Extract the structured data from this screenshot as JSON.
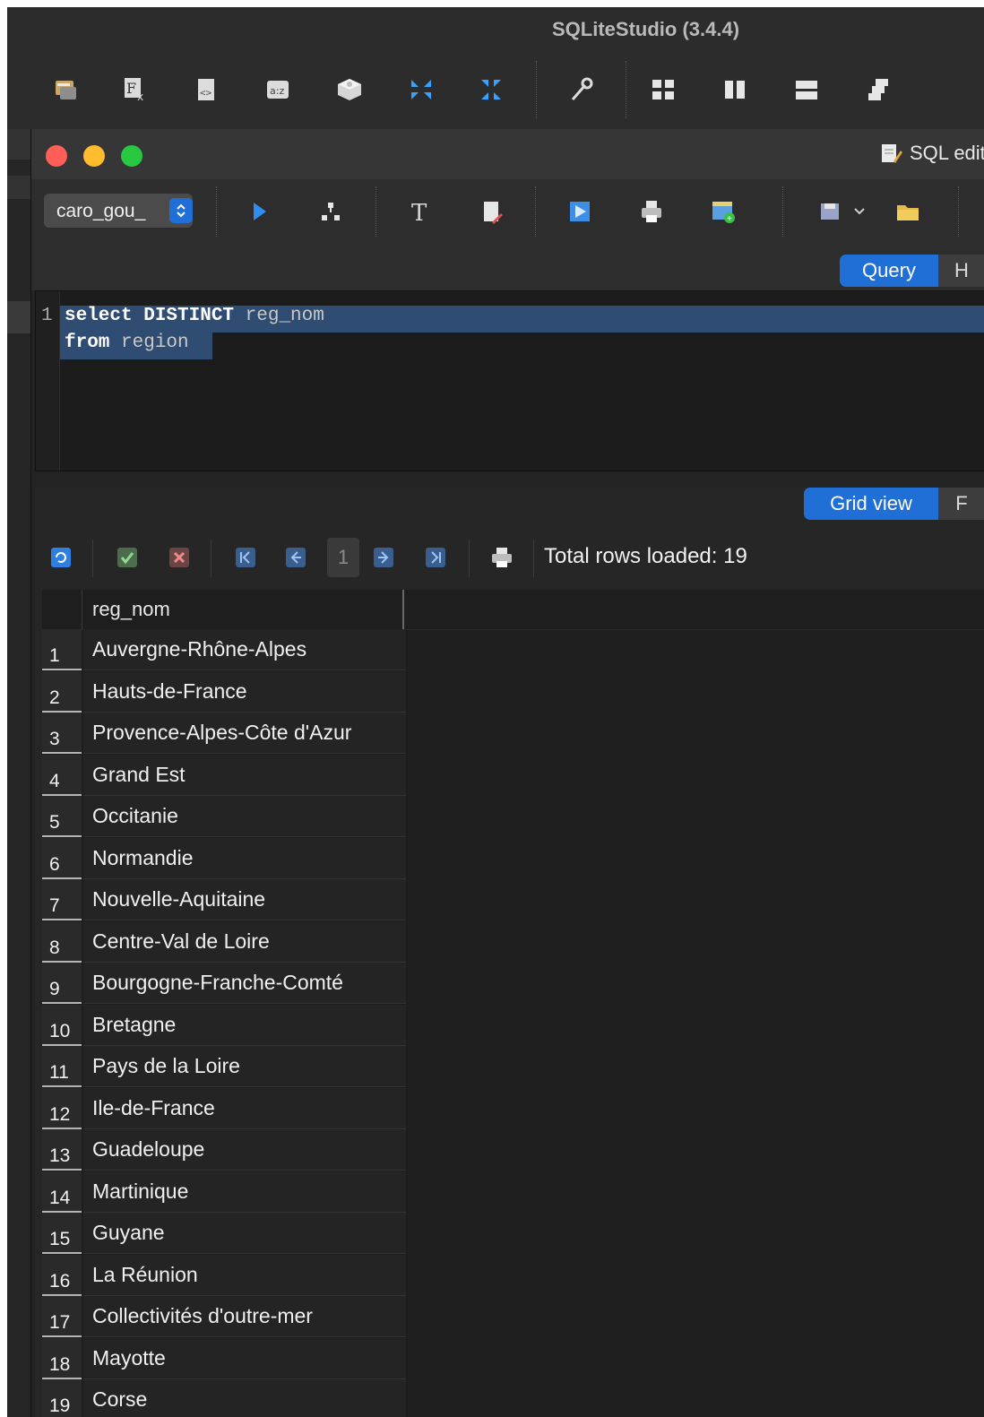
{
  "app": {
    "title": "SQLiteStudio (3.4.4)"
  },
  "editor_window": {
    "title": "SQL edito",
    "database_selector": {
      "value": "caro_gou_"
    },
    "tabs": [
      {
        "label": "Query",
        "active": true
      },
      {
        "label": "H",
        "active": false
      }
    ],
    "code_lines": [
      {
        "number": "1",
        "parts": [
          {
            "text": "select DISTINCT",
            "kind": "keyword"
          },
          {
            "text": " reg_nom",
            "kind": "ident"
          }
        ]
      },
      {
        "number": "",
        "parts": [
          {
            "text": "from",
            "kind": "keyword"
          },
          {
            "text": " region",
            "kind": "ident"
          }
        ]
      }
    ]
  },
  "results": {
    "tabs": [
      {
        "label": "Grid view",
        "active": true
      },
      {
        "label": "F",
        "active": false
      }
    ],
    "current_page": "1",
    "rows_loaded_label": "Total rows loaded: 19",
    "column_header": "reg_nom",
    "rows": [
      {
        "n": "1",
        "value": "Auvergne-Rhône-Alpes"
      },
      {
        "n": "2",
        "value": "Hauts-de-France"
      },
      {
        "n": "3",
        "value": "Provence-Alpes-Côte d'Azur"
      },
      {
        "n": "4",
        "value": "Grand Est"
      },
      {
        "n": "5",
        "value": "Occitanie"
      },
      {
        "n": "6",
        "value": "Normandie"
      },
      {
        "n": "7",
        "value": "Nouvelle-Aquitaine"
      },
      {
        "n": "8",
        "value": "Centre-Val de Loire"
      },
      {
        "n": "9",
        "value": "Bourgogne-Franche-Comté"
      },
      {
        "n": "10",
        "value": "Bretagne"
      },
      {
        "n": "11",
        "value": "Pays de la Loire"
      },
      {
        "n": "12",
        "value": "Ile-de-France"
      },
      {
        "n": "13",
        "value": "Guadeloupe"
      },
      {
        "n": "14",
        "value": "Martinique"
      },
      {
        "n": "15",
        "value": "Guyane"
      },
      {
        "n": "16",
        "value": "La Réunion"
      },
      {
        "n": "17",
        "value": "Collectivités d'outre-mer"
      },
      {
        "n": "18",
        "value": "Mayotte"
      },
      {
        "n": "19",
        "value": "Corse"
      }
    ]
  },
  "colors": {
    "accent_blue": "#1f6fd6",
    "selection": "#2f4d72",
    "close": "#ff5f57",
    "minimize": "#febc2e",
    "zoom": "#28c840"
  }
}
